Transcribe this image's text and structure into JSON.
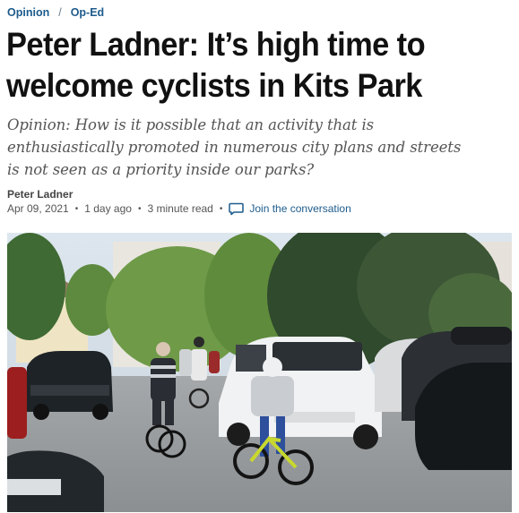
{
  "breadcrumb": {
    "items": [
      {
        "label": "Opinion"
      },
      {
        "label": "Op-Ed"
      }
    ],
    "separator": "/"
  },
  "article": {
    "headline_lines": [
      "Peter Ladner: It’s high time to",
      "welcome cyclists in Kits Park"
    ],
    "deck_lines": [
      "Opinion: How is it possible that an activity that is",
      "enthusiastically promoted in numerous city plans and streets",
      "is not seen as a priority inside our parks?"
    ],
    "author": "Peter Ladner",
    "date": "Apr 09, 2021",
    "relative_time": "1 day ago",
    "read_time": "3 minute read",
    "conversation_link": "Join the conversation",
    "meta_separator": "•"
  },
  "colors": {
    "link": "#1d5b8c",
    "headline": "#111111",
    "deck": "#555555"
  },
  "icons": {
    "conversation": "speech-bubble-icon"
  }
}
